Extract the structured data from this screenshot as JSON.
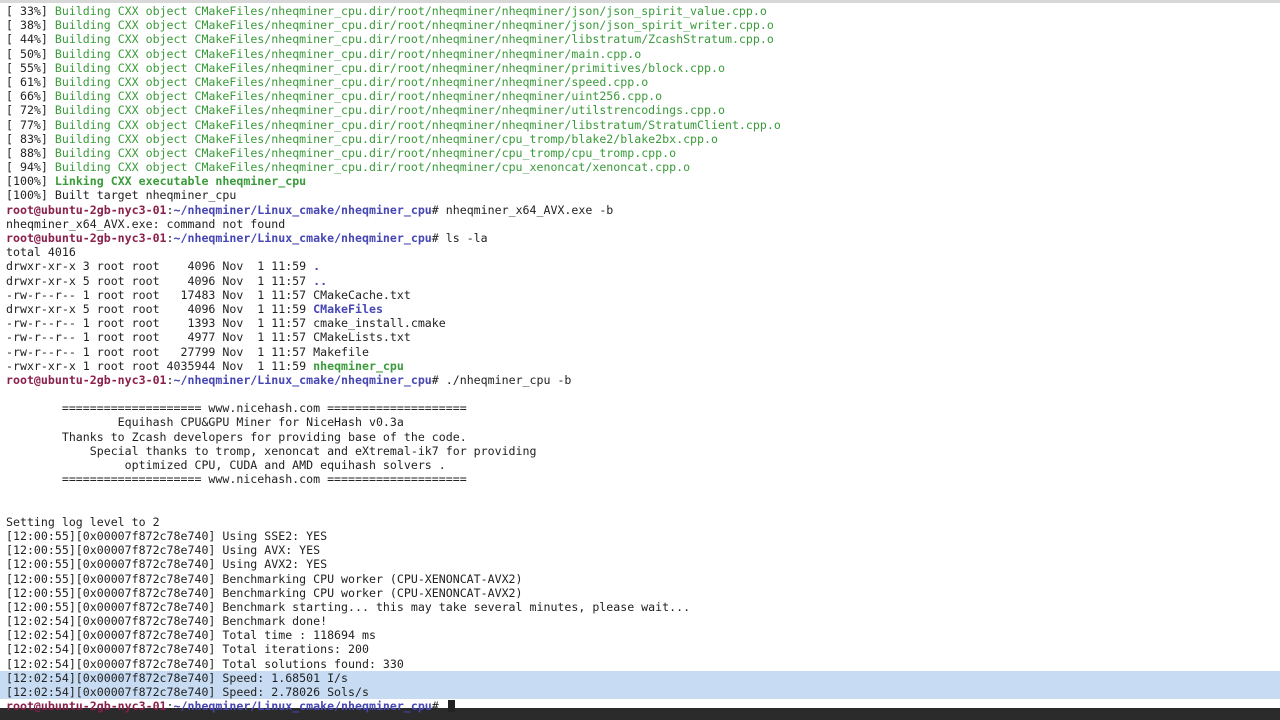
{
  "terminal": {
    "build_lines": [
      {
        "pct": "[ 33%] ",
        "text": "Building CXX object CMakeFiles/nheqminer_cpu.dir/root/nheqminer/nheqminer/json/json_spirit_value.cpp.o"
      },
      {
        "pct": "[ 38%] ",
        "text": "Building CXX object CMakeFiles/nheqminer_cpu.dir/root/nheqminer/nheqminer/json/json_spirit_writer.cpp.o"
      },
      {
        "pct": "[ 44%] ",
        "text": "Building CXX object CMakeFiles/nheqminer_cpu.dir/root/nheqminer/nheqminer/libstratum/ZcashStratum.cpp.o"
      },
      {
        "pct": "[ 50%] ",
        "text": "Building CXX object CMakeFiles/nheqminer_cpu.dir/root/nheqminer/nheqminer/main.cpp.o"
      },
      {
        "pct": "[ 55%] ",
        "text": "Building CXX object CMakeFiles/nheqminer_cpu.dir/root/nheqminer/nheqminer/primitives/block.cpp.o"
      },
      {
        "pct": "[ 61%] ",
        "text": "Building CXX object CMakeFiles/nheqminer_cpu.dir/root/nheqminer/nheqminer/speed.cpp.o"
      },
      {
        "pct": "[ 66%] ",
        "text": "Building CXX object CMakeFiles/nheqminer_cpu.dir/root/nheqminer/nheqminer/uint256.cpp.o"
      },
      {
        "pct": "[ 72%] ",
        "text": "Building CXX object CMakeFiles/nheqminer_cpu.dir/root/nheqminer/nheqminer/utilstrencodings.cpp.o"
      },
      {
        "pct": "[ 77%] ",
        "text": "Building CXX object CMakeFiles/nheqminer_cpu.dir/root/nheqminer/nheqminer/libstratum/StratumClient.cpp.o"
      },
      {
        "pct": "[ 83%] ",
        "text": "Building CXX object CMakeFiles/nheqminer_cpu.dir/root/nheqminer/cpu_tromp/blake2/blake2bx.cpp.o"
      },
      {
        "pct": "[ 88%] ",
        "text": "Building CXX object CMakeFiles/nheqminer_cpu.dir/root/nheqminer/cpu_tromp/cpu_tromp.cpp.o"
      },
      {
        "pct": "[ 94%] ",
        "text": "Building CXX object CMakeFiles/nheqminer_cpu.dir/root/nheqminer/cpu_xenoncat/xenoncat.cpp.o"
      }
    ],
    "link_pct": "[100%] ",
    "link_text": "Linking CXX executable nheqminer_cpu",
    "built_target": "[100%] Built target nheqminer_cpu",
    "prompt": {
      "user_host": "root@ubuntu-2gb-nyc3-01",
      "sep": ":",
      "path": "~/nheqminer/Linux_cmake/nheqminer_cpu",
      "end": "# "
    },
    "cmd1": "nheqminer_x64_AVX.exe -b",
    "cmd1_output": "nheqminer_x64_AVX.exe: command not found",
    "cmd2": "ls -la",
    "ls_total": "total 4016",
    "ls_rows": [
      {
        "meta": "drwxr-xr-x 3 root root    4096 Nov  1 11:59 ",
        "name": ".",
        "kind": "dir"
      },
      {
        "meta": "drwxr-xr-x 5 root root    4096 Nov  1 11:57 ",
        "name": "..",
        "kind": "dir"
      },
      {
        "meta": "-rw-r--r-- 1 root root   17483 Nov  1 11:57 ",
        "name": "CMakeCache.txt",
        "kind": "file"
      },
      {
        "meta": "drwxr-xr-x 5 root root    4096 Nov  1 11:59 ",
        "name": "CMakeFiles",
        "kind": "dir"
      },
      {
        "meta": "-rw-r--r-- 1 root root    1393 Nov  1 11:57 ",
        "name": "cmake_install.cmake",
        "kind": "file"
      },
      {
        "meta": "-rw-r--r-- 1 root root    4977 Nov  1 11:57 ",
        "name": "CMakeLists.txt",
        "kind": "file"
      },
      {
        "meta": "-rw-r--r-- 1 root root   27799 Nov  1 11:57 ",
        "name": "Makefile",
        "kind": "file"
      },
      {
        "meta": "-rwxr-xr-x 1 root root 4035944 Nov  1 11:59 ",
        "name": "nheqminer_cpu",
        "kind": "exec"
      }
    ],
    "cmd3": "./nheqminer_cpu -b",
    "banner": [
      "        ==================== www.nicehash.com ====================",
      "                Equihash CPU&GPU Miner for NiceHash v0.3a",
      "        Thanks to Zcash developers for providing base of the code.",
      "            Special thanks to tromp, xenoncat and eXtremal-ik7 for providing",
      "                 optimized CPU, CUDA and AMD equihash solvers .",
      "        ==================== www.nicehash.com ===================="
    ],
    "log_level": "Setting log level to 2",
    "log_lines": [
      "[12:00:55][0x00007f872c78e740] Using SSE2: YES",
      "[12:00:55][0x00007f872c78e740] Using AVX: YES",
      "[12:00:55][0x00007f872c78e740] Using AVX2: YES",
      "[12:00:55][0x00007f872c78e740] Benchmarking CPU worker (CPU-XENONCAT-AVX2)",
      "[12:00:55][0x00007f872c78e740] Benchmarking CPU worker (CPU-XENONCAT-AVX2)",
      "[12:00:55][0x00007f872c78e740] Benchmark starting... this may take several minutes, please wait...",
      "[12:02:54][0x00007f872c78e740] Benchmark done!",
      "[12:02:54][0x00007f872c78e740] Total time : 118694 ms",
      "[12:02:54][0x00007f872c78e740] Total iterations: 200",
      "[12:02:54][0x00007f872c78e740] Total solutions found: 330"
    ],
    "speed_line_1": "[12:02:54][0x00007f872c78e740] Speed: 1.68501 I/s",
    "speed_line_2": "[12:02:54][0x00007f872c78e740] Speed: 2.78026 Sols/s",
    "colors": {
      "background": "#ffffff",
      "text": "#222222",
      "green": "#3a9b3a",
      "prompt_user": "#8a1f4a",
      "prompt_path": "#4646b4",
      "selection": "#c7dcf3"
    }
  }
}
